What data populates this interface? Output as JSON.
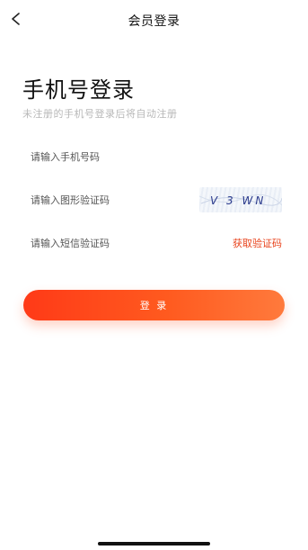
{
  "navbar": {
    "title": "会员登录",
    "back_icon": "chevron-left-icon"
  },
  "heading": {
    "title": "手机号登录",
    "subtitle": "未注册的手机号登录后将自动注册"
  },
  "form": {
    "phone_placeholder": "请输入手机号码",
    "captcha_placeholder": "请输入图形验证码",
    "sms_placeholder": "请输入短信验证码",
    "captcha_text": "V 3 WN",
    "sms_button_label": "获取验证码",
    "login_button_label": "登 录"
  },
  "colors": {
    "accent": "#e8421b",
    "button_gradient_start": "#ff3a17",
    "button_gradient_end": "#ff7a3c",
    "captcha_text": "#2a3a8c"
  }
}
